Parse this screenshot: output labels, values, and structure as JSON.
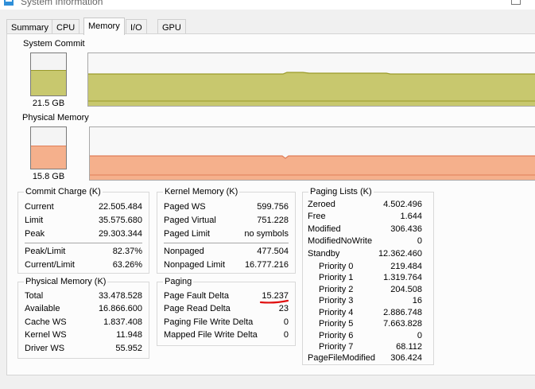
{
  "window": {
    "title": "System Information"
  },
  "tabs": [
    {
      "label": "Summary",
      "active": false
    },
    {
      "label": "CPU",
      "active": false
    },
    {
      "label": "Memory",
      "active": true
    },
    {
      "label": "I/O",
      "active": false
    },
    {
      "label": "GPU",
      "active": false
    }
  ],
  "colors": {
    "commit": "#c8c86e",
    "commit_line": "#9a9a2a",
    "physical": "#f5b08c",
    "physical_line": "#e07e58"
  },
  "system_commit": {
    "label": "System Commit",
    "value": "21.5 GB",
    "level": 0.6
  },
  "physical_memory_gauge": {
    "label": "Physical Memory",
    "value": "15.8 GB",
    "level": 0.55
  },
  "commit_charge": {
    "title": "Commit Charge (K)",
    "rows": [
      {
        "k": "Current",
        "v": "22.505.484"
      },
      {
        "k": "Limit",
        "v": "35.575.680"
      },
      {
        "k": "Peak",
        "v": "29.303.344"
      },
      {
        "k": "Peak/Limit",
        "v": "82.37%"
      },
      {
        "k": "Current/Limit",
        "v": "63.26%"
      }
    ]
  },
  "physical_memory": {
    "title": "Physical Memory (K)",
    "rows": [
      {
        "k": "Total",
        "v": "33.478.528"
      },
      {
        "k": "Available",
        "v": "16.866.600"
      },
      {
        "k": "Cache WS",
        "v": "1.837.408"
      },
      {
        "k": "Kernel WS",
        "v": "11.948"
      },
      {
        "k": "Driver WS",
        "v": "55.952"
      }
    ]
  },
  "kernel_memory": {
    "title": "Kernel Memory (K)",
    "rows": [
      {
        "k": "Paged WS",
        "v": "599.756"
      },
      {
        "k": "Paged Virtual",
        "v": "751.228"
      },
      {
        "k": "Paged Limit",
        "v": "no symbols"
      },
      {
        "k": "Nonpaged",
        "v": "477.504"
      },
      {
        "k": "Nonpaged Limit",
        "v": "16.777.216"
      }
    ]
  },
  "paging": {
    "title": "Paging",
    "rows": [
      {
        "k": "Page Fault Delta",
        "v": "15.237"
      },
      {
        "k": "Page Read Delta",
        "v": "23"
      },
      {
        "k": "Paging File Write Delta",
        "v": "0"
      },
      {
        "k": "Mapped File Write Delta",
        "v": "0"
      }
    ]
  },
  "paging_lists": {
    "title": "Paging Lists (K)",
    "rows": [
      {
        "k": "Zeroed",
        "v": "4.502.496"
      },
      {
        "k": "Free",
        "v": "1.644"
      },
      {
        "k": "Modified",
        "v": "306.436"
      },
      {
        "k": "ModifiedNoWrite",
        "v": "0"
      },
      {
        "k": "Standby",
        "v": "12.362.460"
      },
      {
        "k": "Priority 0",
        "v": "219.484"
      },
      {
        "k": "Priority 1",
        "v": "1.319.764"
      },
      {
        "k": "Priority 2",
        "v": "204.508"
      },
      {
        "k": "Priority 3",
        "v": "16"
      },
      {
        "k": "Priority 4",
        "v": "2.886.748"
      },
      {
        "k": "Priority 5",
        "v": "7.663.828"
      },
      {
        "k": "Priority 6",
        "v": "0"
      },
      {
        "k": "Priority 7",
        "v": "68.112"
      },
      {
        "k": "PageFileModified",
        "v": "306.424"
      }
    ]
  }
}
